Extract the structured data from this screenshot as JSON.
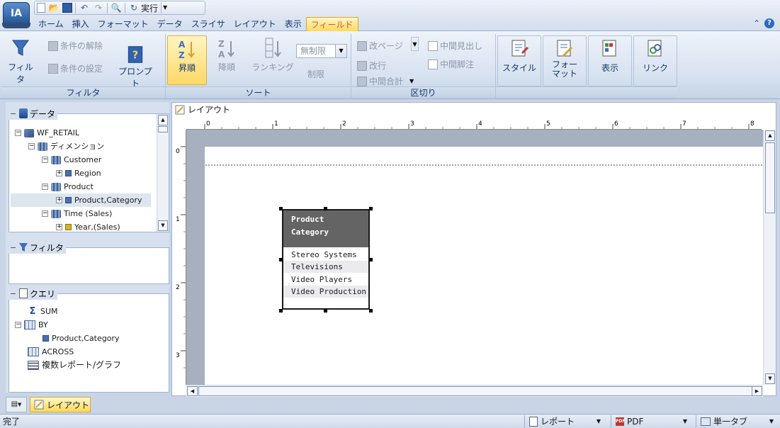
{
  "app": {
    "logo": "IA"
  },
  "qat": {
    "run_label": "実行"
  },
  "tabs": [
    "ホーム",
    "挿入",
    "フォーマット",
    "データ",
    "スライサ",
    "レイアウト",
    "表示",
    "フィールド"
  ],
  "ribbon": {
    "filter_group": {
      "label": "フィルタ",
      "filter_btn": "フィルタ",
      "clear_cond": "条件の解除",
      "set_cond": "条件の設定",
      "prompt_btn": "プロンプト"
    },
    "sort_group": {
      "label": "ソート",
      "asc": "昇順",
      "desc": "降順",
      "ranking": "ランキング",
      "limit_label": "制限",
      "limit_value": "無制限"
    },
    "break_group": {
      "label": "区切り",
      "page_break": "改ページ",
      "line_break": "改行",
      "subtotal": "中間合計",
      "sub_heading": "中間見出し",
      "sub_footing": "中間脚注"
    },
    "style_btn": "スタイル",
    "format_btn_line1": "フォー",
    "format_btn_line2": "マット",
    "display_btn": "表示",
    "link_btn": "リンク"
  },
  "data_panel": {
    "title": "データ",
    "items": [
      "WF_RETAIL",
      "ディメンション",
      "Customer",
      "Region",
      "Product",
      "Product,Category",
      "Time (Sales)",
      "Year,(Sales)"
    ]
  },
  "filter_panel": {
    "title": "フィルタ"
  },
  "query_panel": {
    "title": "クエリ",
    "items": [
      "SUM",
      "BY",
      "Product,Category",
      "ACROSS",
      "複数レポート/グラフ"
    ]
  },
  "main": {
    "title": "レイアウト",
    "ruler_h": [
      "0",
      "1",
      "2",
      "3",
      "4",
      "5",
      "6",
      "7",
      "8"
    ],
    "ruler_v": [
      "0",
      "1",
      "2",
      "3"
    ],
    "report": {
      "header_line1": "Product",
      "header_line2": "Category",
      "rows": [
        "Stereo Systems",
        "Televisions",
        "Video Players",
        "Video Production"
      ]
    }
  },
  "bottom_tab": {
    "label": "レイアウト"
  },
  "status": {
    "text": "完了",
    "output_type": "レポート",
    "format": "PDF",
    "tab_mode": "単一タブ"
  }
}
